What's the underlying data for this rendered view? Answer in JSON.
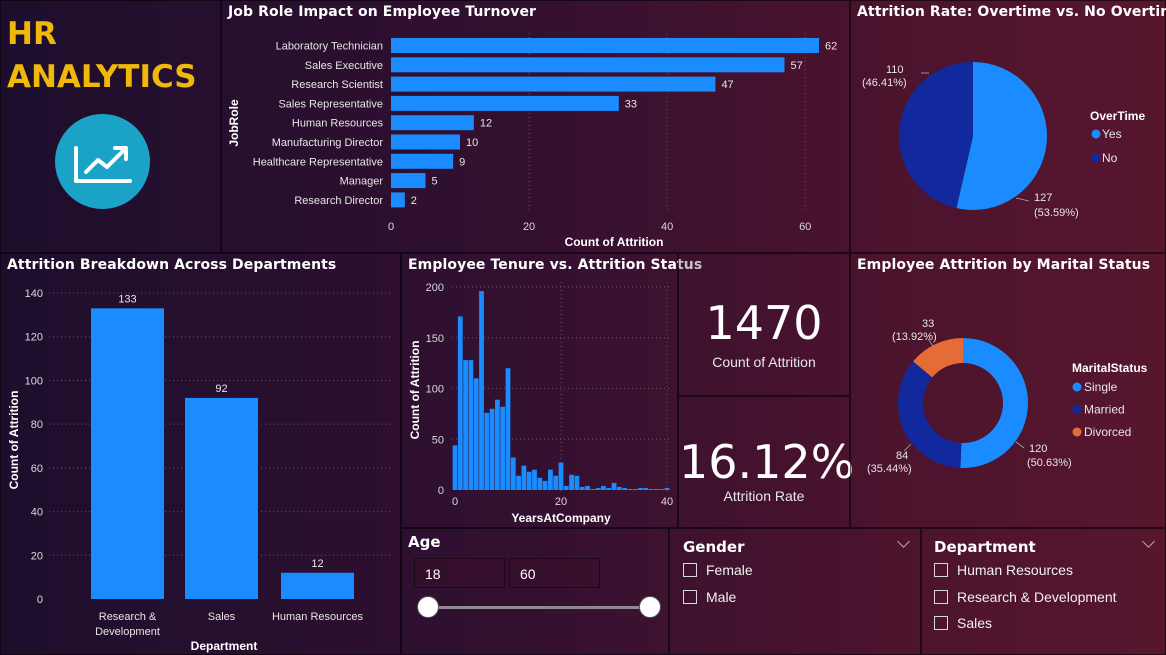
{
  "header": {
    "title_line1": "HR",
    "title_line2": "ANALYTICS",
    "logo_icon": "trending-up-icon"
  },
  "colors": {
    "bar": "#1a8cff",
    "yes": "#1a8cff",
    "no": "#12299e",
    "single": "#1a8cff",
    "married": "#12299e",
    "divorced": "#e66c37",
    "title": "#f0b90a"
  },
  "job_role_chart": {
    "title": "Job Role Impact on Employee Turnover",
    "chart_data": {
      "type": "bar",
      "orientation": "horizontal",
      "categories": [
        "Laboratory Technician",
        "Sales Executive",
        "Research Scientist",
        "Sales Representative",
        "Human Resources",
        "Manufacturing Director",
        "Healthcare Representative",
        "Manager",
        "Research Director"
      ],
      "values": [
        62,
        57,
        47,
        33,
        12,
        10,
        9,
        5,
        2
      ],
      "xlabel": "Count of Attrition",
      "ylabel": "JobRole",
      "xlim": [
        0,
        62
      ],
      "ticks": [
        "0",
        "20",
        "40",
        "60"
      ]
    }
  },
  "overtime_chart": {
    "title": "Attrition Rate: Overtime vs. No Overtime",
    "chart_data": {
      "type": "pie",
      "legend_title": "OverTime",
      "slices": [
        {
          "name": "Yes",
          "value": 127,
          "label": "127",
          "pct": "(53.59%)"
        },
        {
          "name": "No",
          "value": 110,
          "label": "110",
          "pct": "(46.41%)"
        }
      ]
    }
  },
  "department_chart": {
    "title": "Attrition Breakdown Across Departments",
    "chart_data": {
      "type": "bar",
      "categories_line1": [
        "Research &",
        "Sales",
        "Human Resources"
      ],
      "categories_line2": [
        "Development",
        "",
        ""
      ],
      "values": [
        133,
        92,
        12
      ],
      "value_labels": [
        "133",
        "92",
        "12"
      ],
      "xlabel": "Department",
      "ylabel": "Count of Attrition",
      "ylim": [
        0,
        140
      ],
      "ticks": [
        "0",
        "20",
        "40",
        "60",
        "80",
        "100",
        "120",
        "140"
      ]
    }
  },
  "tenure_chart": {
    "title": "Employee Tenure vs. Attrition Status",
    "chart_data": {
      "type": "bar",
      "x": [
        0,
        1,
        2,
        3,
        4,
        5,
        6,
        7,
        8,
        9,
        10,
        11,
        12,
        13,
        14,
        15,
        16,
        17,
        18,
        19,
        20,
        21,
        22,
        23,
        24,
        25,
        26,
        27,
        28,
        29,
        30,
        31,
        32,
        33,
        34,
        35,
        36,
        37,
        38,
        39,
        40
      ],
      "values": [
        44,
        171,
        128,
        128,
        110,
        196,
        76,
        80,
        89,
        82,
        120,
        32,
        14,
        24,
        18,
        20,
        12,
        9,
        20,
        14,
        27,
        4,
        15,
        14,
        3,
        4,
        1,
        2,
        4,
        2,
        7,
        3,
        2,
        1,
        1,
        2,
        2,
        1,
        1,
        1,
        2
      ],
      "xlabel": "YearsAtCompany",
      "ylabel": "Count of Attrition",
      "xlim": [
        0,
        40
      ],
      "ylim": [
        0,
        200
      ],
      "xticks": [
        "0",
        "20",
        "40"
      ],
      "yticks": [
        "0",
        "50",
        "100",
        "150",
        "200"
      ]
    }
  },
  "kpi_count": {
    "value": "1470",
    "label": "Count of Attrition"
  },
  "kpi_rate": {
    "value": "16.12%",
    "label": "Attrition Rate"
  },
  "marital_chart": {
    "title": "Employee Attrition by Marital Status",
    "chart_data": {
      "type": "donut",
      "legend_title": "MaritalStatus",
      "slices": [
        {
          "name": "Single",
          "value": 120,
          "label": "120",
          "pct": "(50.63%)"
        },
        {
          "name": "Married",
          "value": 84,
          "label": "84",
          "pct": "(35.44%)"
        },
        {
          "name": "Divorced",
          "value": 33,
          "label": "33",
          "pct": "(13.92%)"
        }
      ]
    }
  },
  "age_slicer": {
    "title": "Age",
    "min_value": "18",
    "max_value": "60"
  },
  "gender_slicer": {
    "title": "Gender",
    "options": [
      "Female",
      "Male"
    ]
  },
  "department_slicer": {
    "title": "Department",
    "options": [
      "Human Resources",
      "Research & Development",
      "Sales"
    ]
  }
}
